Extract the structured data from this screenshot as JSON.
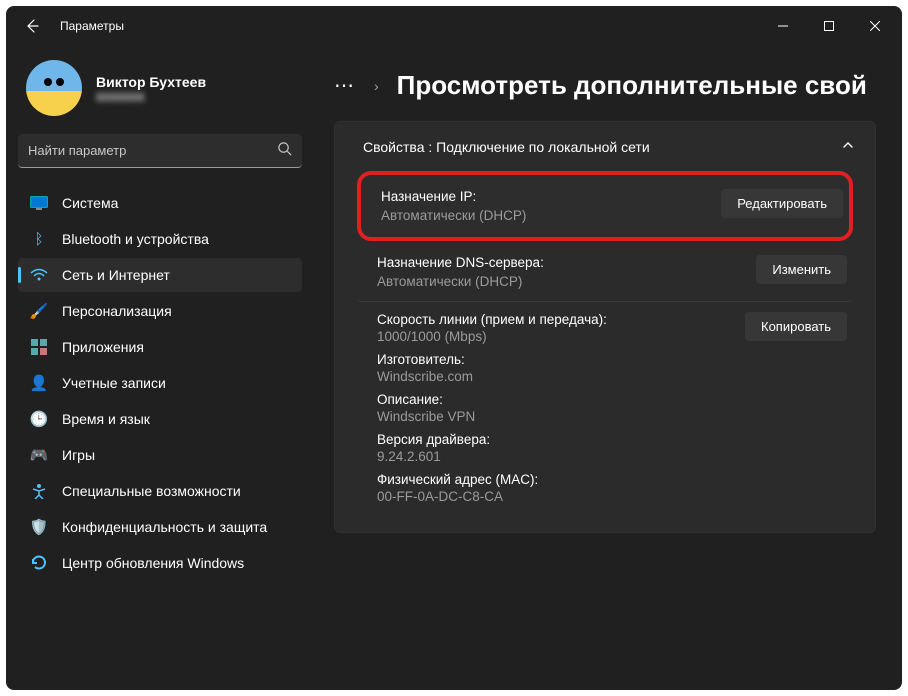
{
  "window": {
    "title": "Параметры"
  },
  "profile": {
    "name": "Виктор Бухтеев",
    "email": "▮▮▮▮▮▮▮▮"
  },
  "search": {
    "placeholder": "Найти параметр"
  },
  "sidebar": {
    "items": [
      {
        "label": "Система",
        "icon": "display-icon"
      },
      {
        "label": "Bluetooth и устройства",
        "icon": "bluetooth-icon"
      },
      {
        "label": "Сеть и Интернет",
        "icon": "wifi-icon"
      },
      {
        "label": "Персонализация",
        "icon": "brush-icon"
      },
      {
        "label": "Приложения",
        "icon": "apps-icon"
      },
      {
        "label": "Учетные записи",
        "icon": "account-icon"
      },
      {
        "label": "Время и язык",
        "icon": "time-icon"
      },
      {
        "label": "Игры",
        "icon": "games-icon"
      },
      {
        "label": "Специальные возможности",
        "icon": "accessibility-icon"
      },
      {
        "label": "Конфиденциальность и защита",
        "icon": "privacy-icon"
      },
      {
        "label": "Центр обновления Windows",
        "icon": "update-icon"
      }
    ]
  },
  "header": {
    "ellipsis": "⋯",
    "title": "Просмотреть дополнительные свой"
  },
  "panel": {
    "title": "Свойства : Подключение по локальной сети",
    "ip": {
      "label": "Назначение IP:",
      "value": "Автоматически (DHCP)",
      "action": "Редактировать"
    },
    "dns": {
      "label": "Назначение DNS-сервера:",
      "value": "Автоматически (DHCP)",
      "action": "Изменить"
    },
    "copy_action": "Копировать",
    "details": [
      {
        "key": "Скорость линии (прием и передача):",
        "value": "1000/1000 (Mbps)"
      },
      {
        "key": "Изготовитель:",
        "value": "Windscribe.com"
      },
      {
        "key": "Описание:",
        "value": "Windscribe VPN"
      },
      {
        "key": "Версия драйвера:",
        "value": "9.24.2.601"
      },
      {
        "key": "Физический адрес (MAC):",
        "value": "00-FF-0A-DC-C8-CA"
      }
    ]
  }
}
